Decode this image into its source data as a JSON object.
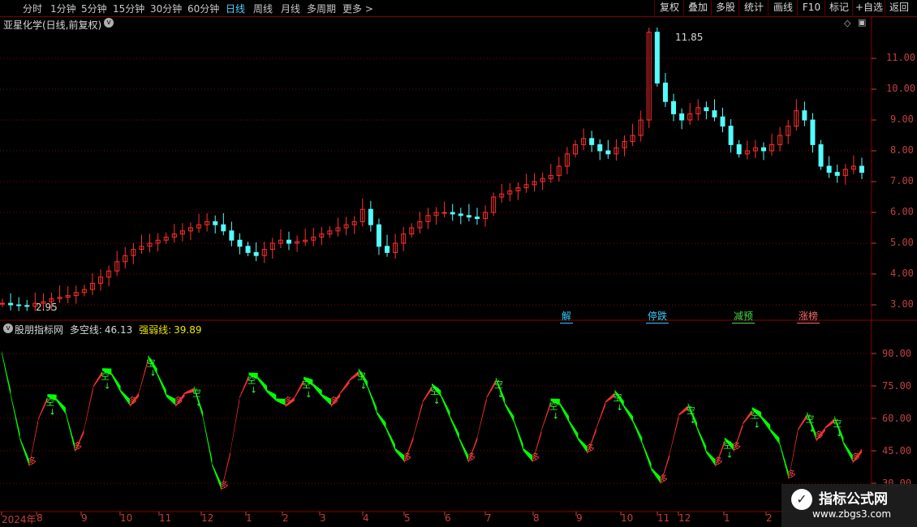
{
  "toolbar": {
    "periods": [
      "分时",
      "1分钟",
      "5分钟",
      "15分钟",
      "30分钟",
      "60分钟",
      "日线",
      "周线",
      "月线",
      "多周期",
      "更多 >"
    ],
    "active_period": "日线",
    "right_buttons": [
      "复权",
      "叠加",
      "多股",
      "统计",
      "画线",
      "F10",
      "标记",
      "+自选",
      "返回"
    ]
  },
  "main_chart": {
    "title": "亚星化学(日线,前复权)",
    "y_ticks": [
      "11.00",
      "10.00",
      "9.00",
      "8.00",
      "7.00",
      "6.00",
      "5.00",
      "4.00",
      "3.00"
    ],
    "high_label": "11.85",
    "low_label": "2.95",
    "events": [
      {
        "text": "解",
        "color": "#33ccff"
      },
      {
        "text": "停跌",
        "color": "#33ccff"
      },
      {
        "text": "减预",
        "color": "#44dd44"
      },
      {
        "text": "涨榜",
        "color": "#ff5555"
      }
    ]
  },
  "indicator": {
    "name": "股朋指标网",
    "line1_label": "多空线:",
    "line1_value": "46.13",
    "line2_label": "强弱线:",
    "line2_value": "39.89",
    "y_ticks": [
      "90.00",
      "75.00",
      "60.00",
      "45.00",
      "30.00"
    ],
    "short_mark": "空",
    "long_mark": "多"
  },
  "x_axis": {
    "labels": [
      "2024年",
      "8",
      "9",
      "10",
      "11",
      "12",
      "1",
      "2",
      "3",
      "4",
      "5",
      "6",
      "7",
      "8",
      "9",
      "10",
      "11",
      "12",
      "1",
      "2"
    ]
  },
  "watermark": {
    "line1": "指标公式网",
    "line2": "www.zbgs3.com"
  },
  "colors": {
    "up": "#ff3030",
    "down": "#00ff00",
    "grid": "#8b0000",
    "axis": "#c04040",
    "cyan": "#54fcfc"
  },
  "chart_data": {
    "type": "candlestick",
    "price_series": [
      3.05,
      3.0,
      2.98,
      2.95,
      3.05,
      3.1,
      3.2,
      3.25,
      3.3,
      3.4,
      3.5,
      3.7,
      3.9,
      4.1,
      4.4,
      4.6,
      4.8,
      4.9,
      5.0,
      5.1,
      5.2,
      5.3,
      5.4,
      5.5,
      5.6,
      5.7,
      5.6,
      5.4,
      5.1,
      4.9,
      4.7,
      4.6,
      4.8,
      5.0,
      5.1,
      5.0,
      5.05,
      5.1,
      5.2,
      5.3,
      5.4,
      5.5,
      5.6,
      5.7,
      6.1,
      5.6,
      4.9,
      4.7,
      5.0,
      5.3,
      5.5,
      5.7,
      5.9,
      6.0,
      6.0,
      5.95,
      5.9,
      5.85,
      5.8,
      6.0,
      6.5,
      6.6,
      6.7,
      6.8,
      6.9,
      7.0,
      7.1,
      7.2,
      7.5,
      7.9,
      8.2,
      8.4,
      8.2,
      8.0,
      7.9,
      8.1,
      8.3,
      8.5,
      9.0,
      11.85,
      10.2,
      9.6,
      9.2,
      9.0,
      9.2,
      9.4,
      9.3,
      9.1,
      8.8,
      8.2,
      7.9,
      8.0,
      8.1,
      8.0,
      8.2,
      8.5,
      8.8,
      9.3,
      9.0,
      8.2,
      7.5,
      7.3,
      7.2,
      7.4,
      7.5,
      7.3
    ],
    "indicator_series": [
      90,
      70,
      50,
      38,
      60,
      70,
      68,
      62,
      45,
      55,
      75,
      82,
      80,
      72,
      66,
      72,
      88,
      80,
      70,
      66,
      72,
      74,
      60,
      38,
      27,
      45,
      70,
      80,
      78,
      72,
      68,
      66,
      70,
      78,
      75,
      70,
      66,
      72,
      78,
      82,
      74,
      62,
      55,
      45,
      40,
      52,
      68,
      75,
      70,
      60,
      50,
      40,
      52,
      70,
      78,
      66,
      58,
      45,
      40,
      55,
      68,
      66,
      58,
      50,
      44,
      56,
      68,
      72,
      65,
      58,
      48,
      36,
      30,
      44,
      62,
      66,
      55,
      44,
      38,
      50,
      45,
      58,
      64,
      60,
      54,
      48,
      32,
      55,
      62,
      50,
      56,
      60,
      48,
      40,
      46
    ]
  }
}
